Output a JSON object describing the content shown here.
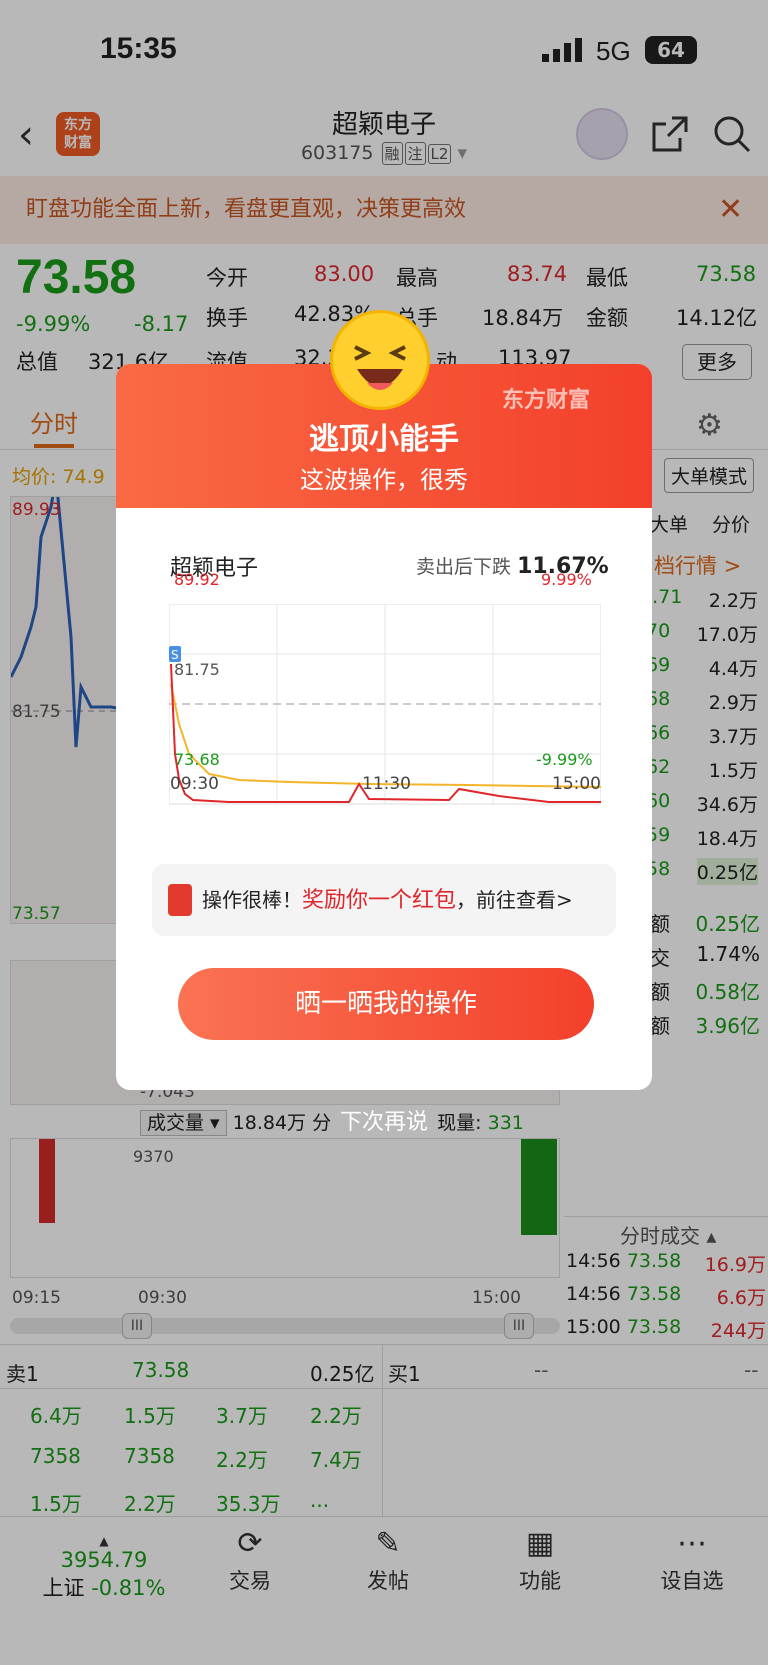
{
  "status": {
    "time": "15:35",
    "network": "5G",
    "battery": "64"
  },
  "header": {
    "brand_logo": "东方财富",
    "stock_name": "超颖电子",
    "stock_code": "603175",
    "tags": [
      "融",
      "注",
      "L2"
    ]
  },
  "banner": {
    "text": "盯盘功能全面上新，看盘更直观，决策更高效"
  },
  "quote": {
    "price": "73.58",
    "pct": "-9.99%",
    "change": "-8.17",
    "kai_label": "今开",
    "kai": "83.00",
    "gao_label": "最高",
    "gao": "83.74",
    "di_label": "最低",
    "di": "73.58",
    "huanshou_label": "换手",
    "huanshou": "42.83%",
    "zongshou_label": "总手",
    "zongshou": "18.84万",
    "jine_label": "金额",
    "jine": "14.12亿",
    "zongzhi_label": "总值",
    "zongzhi": "321.6亿",
    "liuzhi_label": "流值",
    "liuzhi": "32.3",
    "zhendong_label": "动",
    "zhendong": "113.97",
    "more": "更多"
  },
  "tabs": {
    "active": "分时",
    "avg_label": "均价:",
    "avg_value": "74.9",
    "mode": "大单模式"
  },
  "chart": {
    "high": "89.93",
    "low": "73.57",
    "mid": "81.75",
    "vol_low": "-7.043",
    "vol_max": "9370",
    "times": [
      "09:15",
      "09:30",
      "15:00"
    ]
  },
  "volume_bar": {
    "label": "成交量",
    "volume": "18.84万",
    "extra": "分",
    "current_label": "现量:",
    "current": "331"
  },
  "right_panel": {
    "header": [
      "大单",
      "分价"
    ],
    "link": "档行情 >",
    "rows": [
      {
        "p": "3.71",
        "v": "2.2万"
      },
      {
        "p": ".70",
        "v": "17.0万"
      },
      {
        "p": ".69",
        "v": "4.4万"
      },
      {
        "p": ".68",
        "v": "2.9万"
      },
      {
        "p": ".66",
        "v": "3.7万"
      },
      {
        "p": ".62",
        "v": "1.5万"
      },
      {
        "p": ".60",
        "v": "34.6万"
      },
      {
        "p": ".59",
        "v": "18.4万"
      },
      {
        "p": ".58",
        "v": "0.25亿"
      }
    ],
    "stats": [
      {
        "l": "额",
        "v": "0.25亿"
      },
      {
        "l": "交",
        "v": "1.74%"
      },
      {
        "l": "额",
        "v": "0.58亿"
      },
      {
        "l": "额",
        "v": "3.96亿"
      }
    ],
    "ticks_title": "分时成交",
    "ticks": [
      {
        "t": "14:56",
        "p": "73.58",
        "v": "16.9万"
      },
      {
        "t": "14:56",
        "p": "73.58",
        "v": "6.6万"
      },
      {
        "t": "15:00",
        "p": "73.58",
        "v": "244万"
      }
    ]
  },
  "orderbook": {
    "sell_label": "卖1",
    "sell_price": "73.58",
    "sell_amount": "0.25亿",
    "buy_label": "买1",
    "buy_price": "--",
    "buy_amount": "--",
    "rows": [
      [
        "6.4万",
        "1.5万",
        "3.7万",
        "2.2万"
      ],
      [
        "7358",
        "7358",
        "2.2万",
        "7.4万"
      ],
      [
        "1.5万",
        "2.2万",
        "35.3万",
        "..."
      ]
    ]
  },
  "nav": {
    "index_value": "3954.79",
    "index_name": "上证",
    "index_pct": "-0.81%",
    "items": [
      "交易",
      "发帖",
      "功能",
      "设自选"
    ]
  },
  "modal": {
    "title": "逃顶小能手",
    "subtitle": "这波操作，很秀",
    "brand": "东方财富",
    "stock": "超颖电子",
    "drop_label": "卖出后下跌",
    "drop_value": "11.67%",
    "chart": {
      "top_left": "89.92",
      "top_right": "9.99%",
      "mid": "81.75",
      "bottom_left": "73.68",
      "bottom_right": "-9.99%",
      "times": [
        "09:30",
        "11:30",
        "15:00"
      ],
      "marker": "S"
    },
    "reward_pre": "操作很棒！",
    "reward_red": "奖励你一个红包",
    "reward_post": "，前往查看>",
    "button": "晒一晒我的操作",
    "later": "下次再说"
  }
}
